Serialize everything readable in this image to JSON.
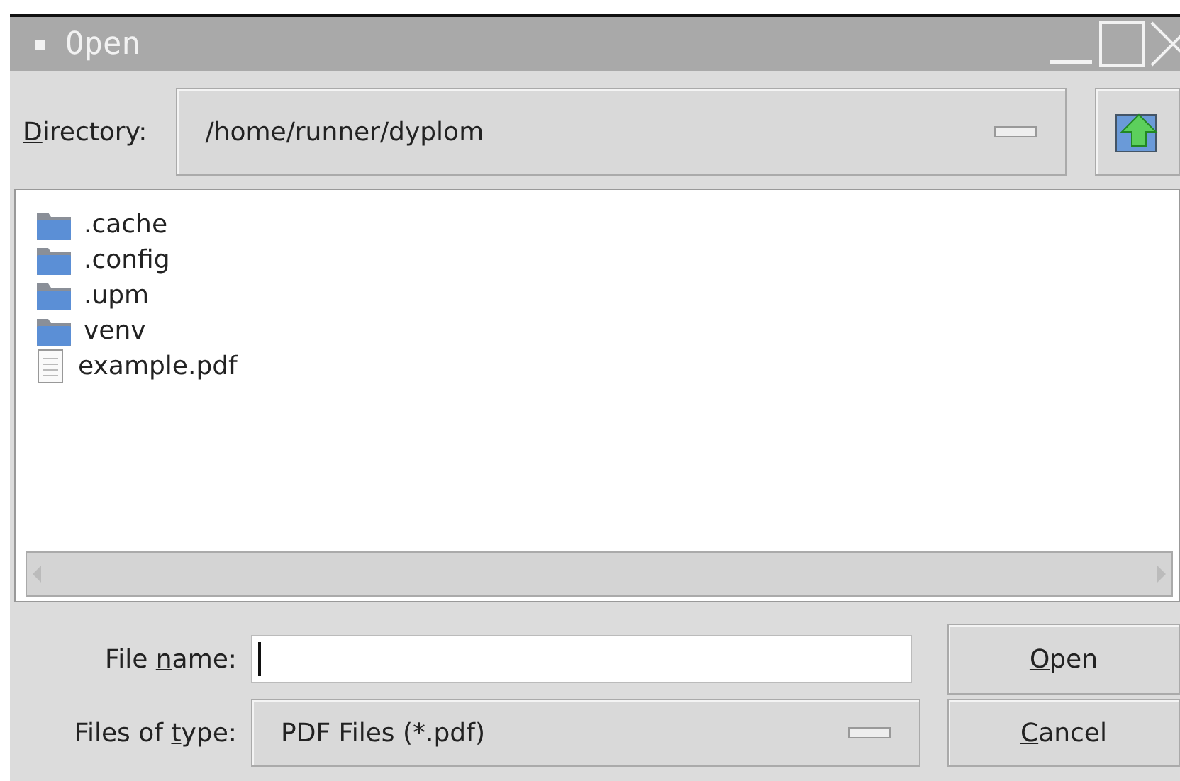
{
  "window": {
    "title": "Open"
  },
  "directory": {
    "label": {
      "key": "D",
      "post": "irectory:"
    },
    "value": "/home/runner/dyplom"
  },
  "files": [
    {
      "name": ".cache",
      "kind": "folder"
    },
    {
      "name": ".config",
      "kind": "folder"
    },
    {
      "name": ".upm",
      "kind": "folder"
    },
    {
      "name": "venv",
      "kind": "folder"
    },
    {
      "name": "example.pdf",
      "kind": "file"
    }
  ],
  "file_name": {
    "label": {
      "pre": "File ",
      "key": "n",
      "post": "ame:"
    }
  },
  "file_type": {
    "label": {
      "pre": "Files of ",
      "key": "t",
      "post": "ype:"
    },
    "value": "PDF Files (*.pdf)"
  },
  "buttons": [
    {
      "key": "O",
      "post": "pen"
    },
    {
      "key": "C",
      "post": "ancel"
    }
  ]
}
